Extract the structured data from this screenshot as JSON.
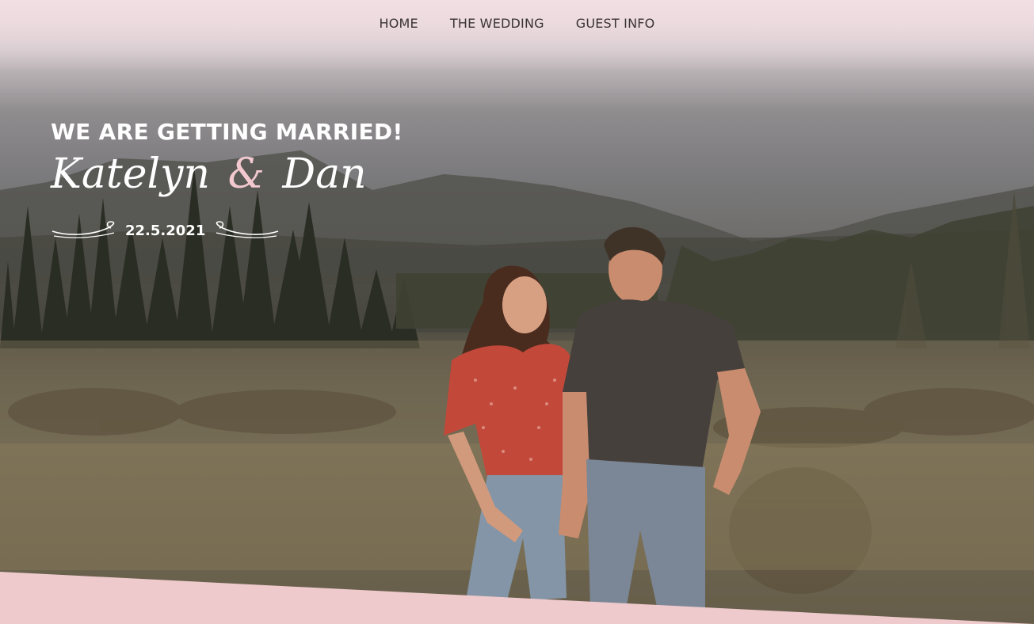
{
  "nav": {
    "items": [
      {
        "label": "HOME"
      },
      {
        "label": "THE WEDDING"
      },
      {
        "label": "GUEST INFO"
      }
    ]
  },
  "hero": {
    "headline": "WE ARE GETTING MARRIED!",
    "name_1": "Katelyn",
    "ampersand": "&",
    "name_2": "Dan",
    "date": "22.5.2021"
  },
  "colors": {
    "accent_pink": "#f2c9cf",
    "text_white": "#ffffff",
    "nav_text": "#3a3434"
  }
}
